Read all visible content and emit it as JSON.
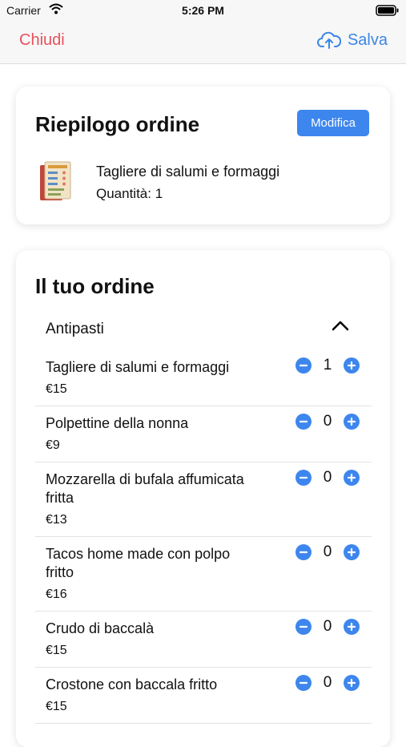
{
  "status_bar": {
    "carrier": "Carrier",
    "time": "5:26 PM"
  },
  "nav": {
    "close_label": "Chiudi",
    "save_label": "Salva"
  },
  "summary": {
    "title": "Riepilogo ordine",
    "edit_label": "Modifica",
    "item_name": "Tagliere di salumi e formaggi",
    "item_quantity": "Quantità: 1"
  },
  "order": {
    "title": "Il tuo ordine",
    "section": "Antipasti",
    "items": [
      {
        "name": "Tagliere di salumi e formaggi",
        "price": "€15",
        "qty": "1"
      },
      {
        "name": "Polpettine della nonna",
        "price": "€9",
        "qty": "0"
      },
      {
        "name": "Mozzarella di bufala affumicata fritta",
        "price": "€13",
        "qty": "0"
      },
      {
        "name": "Tacos home made con polpo fritto",
        "price": "€16",
        "qty": "0"
      },
      {
        "name": "Crudo di baccalà",
        "price": "€15",
        "qty": "0"
      },
      {
        "name": "Crostone con baccala fritto",
        "price": "€15",
        "qty": "0"
      }
    ]
  },
  "colors": {
    "accent": "#3d86ee",
    "close": "#e8505b"
  }
}
